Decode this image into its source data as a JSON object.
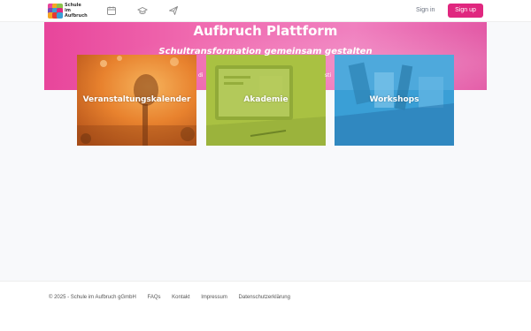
{
  "header": {
    "logo_text": "Schule\nim\nAufbruch",
    "nav_icons": [
      "calendar-icon",
      "graduation-cap-icon",
      "send-icon"
    ],
    "signin_label": "Sign in",
    "signup_label": "Sign up",
    "accent": "#e0277f"
  },
  "hero": {
    "title": "Aufbruch Plattform",
    "subtitle": "Schultransformation gemeinsam gestalten",
    "text_left": "di",
    "text_right": "sti"
  },
  "cards": [
    {
      "label": "Veranstaltungskalender",
      "color": "#e8822e"
    },
    {
      "label": "Akademie",
      "color": "#a9c142"
    },
    {
      "label": "Workshops",
      "color": "#3a9fd6"
    }
  ],
  "footer": {
    "copyright": "© 2025 - Schule im Aufbruch gGmbH",
    "links": [
      "FAQs",
      "Kontakt",
      "Impressum",
      "Datenschutzerklärung"
    ]
  }
}
